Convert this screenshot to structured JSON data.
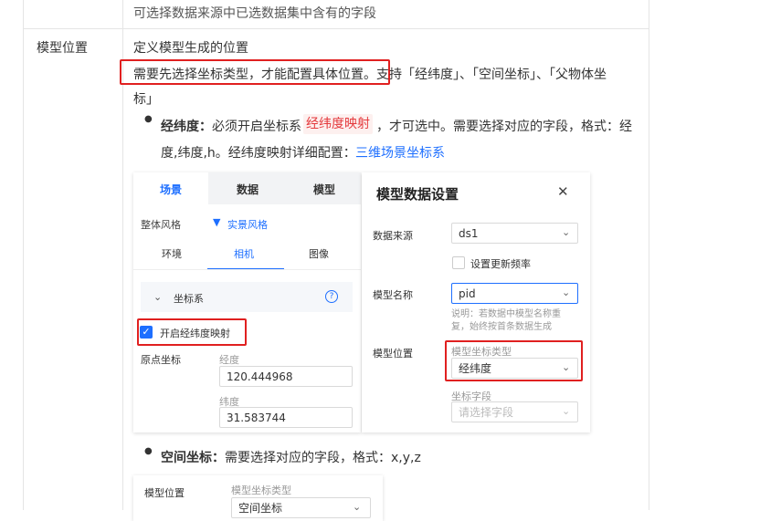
{
  "doc": {
    "top_desc": "可选择数据来源中已选数据集中含有的字段",
    "row_label": "模型位置",
    "def_line": "定义模型生成的位置",
    "highlight_text": "需要先选择坐标类型，才能配置具体位置。",
    "support_text": "支持「经纬度」、「空间坐标」、「父物体坐",
    "support_text_2": "标」",
    "bullet1": {
      "bold": "经纬度：",
      "pre": "必须开启坐标系",
      "tag": "经纬度映射",
      "post": "，才可选中。需要选择对应的字段，格式：经",
      "line2_pre": "度,纬度,h。经纬度映射详细配置：",
      "link": "三维场景坐标系"
    },
    "bullet2": {
      "bold": "空间坐标：",
      "text": "需要选择对应的字段，格式：x,y,z"
    }
  },
  "left_panel": {
    "tabs": [
      "场景",
      "数据",
      "模型"
    ],
    "style_label": "整体风格",
    "style_value": "实景风格",
    "subtabs": [
      "环境",
      "相机",
      "图像"
    ],
    "section": "坐标系",
    "help": "?",
    "checkbox_label": "开启经纬度映射",
    "origin_label": "原点坐标",
    "lon_label": "经度",
    "lon_value": "120.444968",
    "lat_label": "纬度",
    "lat_value": "31.583744"
  },
  "dialog": {
    "title": "模型数据设置",
    "close": "✕",
    "source_label": "数据来源",
    "source_value": "ds1",
    "update_label": "设置更新频率",
    "name_label": "模型名称",
    "name_value": "pid",
    "note": "说明：若数据中模型名称重",
    "note2": "复，始终按首条数据生成",
    "pos_label": "模型位置",
    "coord_type_label": "模型坐标类型",
    "coord_type_value": "经纬度",
    "coord_field_label": "坐标字段",
    "coord_field_placeholder": "请选择字段"
  },
  "bottom_panel": {
    "pos_label": "模型位置",
    "coord_type_label": "模型坐标类型",
    "coord_type_value": "空间坐标"
  },
  "colors": {
    "accent": "#1e6fff",
    "highlight_border": "#e02020",
    "tag_text": "#e4393c"
  }
}
